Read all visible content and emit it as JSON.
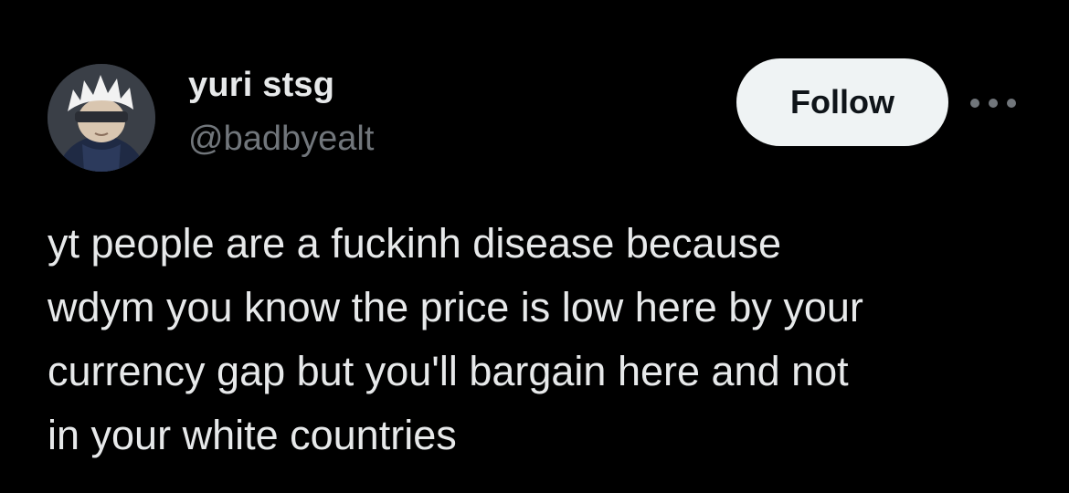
{
  "user": {
    "display_name": "yuri stsg",
    "handle": "@badbyealt"
  },
  "actions": {
    "follow_label": "Follow",
    "more_icon": "more-horizontal-icon"
  },
  "tweet": {
    "lines": [
      "yt people are a fuckinh disease because",
      "wdym you know the price is low here by your",
      "currency gap but you'll bargain here and not",
      "in your white countries"
    ]
  },
  "colors": {
    "background": "#000000",
    "primary_text": "#e7e9ea",
    "secondary_text": "#71767b",
    "follow_button_bg": "#eff3f4",
    "follow_button_text": "#0f1419"
  }
}
